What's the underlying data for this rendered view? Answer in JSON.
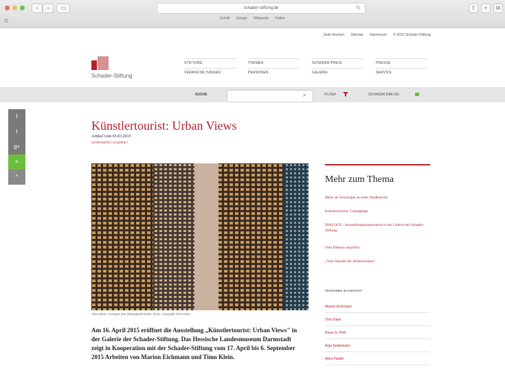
{
  "browser": {
    "url": "schader-stiftung.de",
    "favorites": [
      "Schrift",
      "Google",
      "Wikipedia",
      "Twitter"
    ]
  },
  "toplinks": [
    "Seite drucken",
    "Sitemap",
    "Impressum",
    "© 2015 Schader-Stiftung"
  ],
  "logo": {
    "text": "Schader-Stiftung"
  },
  "nav": [
    [
      "STIFTUNG",
      "THEMEN",
      "SCHADER-PREIS",
      "PRESSE"
    ],
    [
      "VERANSTALTUNGEN",
      "PERSONEN",
      "GALERIE",
      "SERVICE"
    ]
  ],
  "searchbar": {
    "label": "SUCHE",
    "filter": "FILTER",
    "dialog": "SCHADER.DIALOG"
  },
  "social": [
    "f",
    "t",
    "g+",
    "≡",
    "^"
  ],
  "article": {
    "title": "Künstlertourist: Urban Views",
    "date": "Artikel vom 03.03.2015",
    "breadcrumb": "STARTSEITE / GALERIE /",
    "caption": "Timo Klein: Compact Life (Shanghai/F/I202), 2012, Copyright Timo Klein",
    "intro": "Am 16. April 2015 eröffnet die Ausstellung „Künstlertourist: Urban Views\" in der Galerie der Schader-Stiftung. Das Hessische Landesmuseum Darmstadt zeigt in Kooperation mit der Schader-Stiftung vom 17. April bis 6. September 2015 Arbeiten von Marion Eichmann und Timo Klein."
  },
  "aside": {
    "title": "Mehr zum Thema",
    "links": [
      "Mehr als Soziologie an einer Straßenecke",
      "Künstlertourist: Grenzgänge",
      "DIALOGE - Ausstellungskooperation in der Galerie der Schader-Stiftung",
      "Vom Diskurs inspiriert",
      "„Vom Wandel der Arbeitswelten\""
    ],
    "persons_heading": "PERSONEN IM KONTEXT",
    "persons": [
      "Marion Eichmann",
      "Timo Klein",
      "Klaus G. Pohl",
      "Anja Seidemann",
      "Alina Pawlik"
    ]
  }
}
